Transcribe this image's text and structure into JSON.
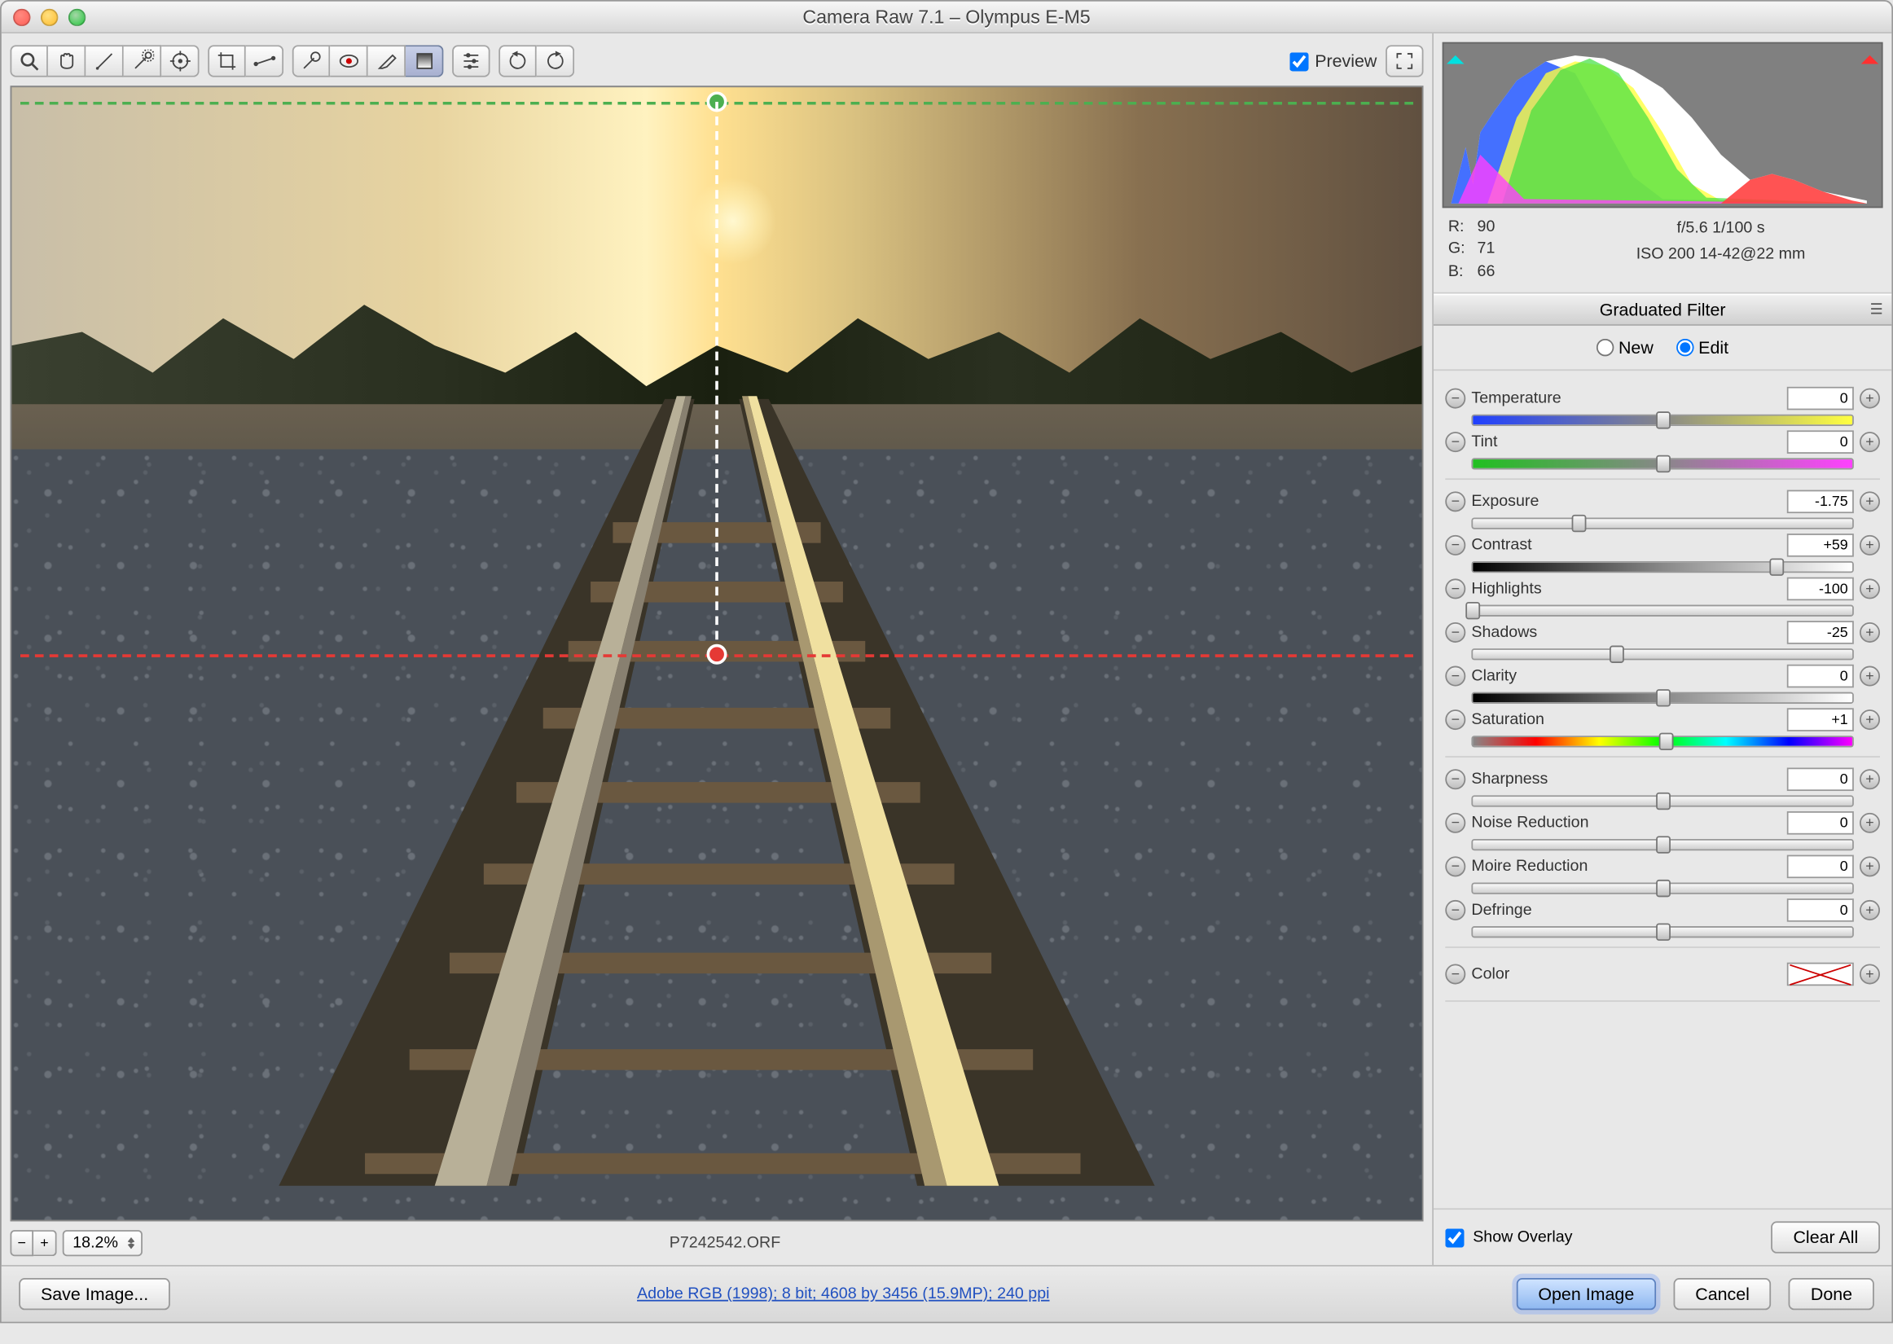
{
  "title": "Camera Raw 7.1  –  Olympus E-M5",
  "toolbar": {
    "preview_label": "Preview",
    "preview_checked": true
  },
  "zoom": "18.2%",
  "filename": "P7242542.ORF",
  "workflow_link": "Adobe RGB (1998); 8 bit; 4608 by 3456 (15.9MP); 240 ppi",
  "buttons": {
    "save": "Save Image...",
    "open": "Open Image",
    "cancel": "Cancel",
    "done": "Done",
    "clear_all": "Clear All"
  },
  "rgb": {
    "r_label": "R:",
    "r": "90",
    "g_label": "G:",
    "g": "71",
    "b_label": "B:",
    "b": "66"
  },
  "camera": {
    "line1": "f/5.6   1/100 s",
    "line2": "ISO 200   14-42@22 mm"
  },
  "panel": {
    "title": "Graduated Filter",
    "new": "New",
    "edit": "Edit"
  },
  "sliders": {
    "temperature": {
      "label": "Temperature",
      "value": "0",
      "pos": 50
    },
    "tint": {
      "label": "Tint",
      "value": "0",
      "pos": 50
    },
    "exposure": {
      "label": "Exposure",
      "value": "-1.75",
      "pos": 28
    },
    "contrast": {
      "label": "Contrast",
      "value": "+59",
      "pos": 80
    },
    "highlights": {
      "label": "Highlights",
      "value": "-100",
      "pos": 0
    },
    "shadows": {
      "label": "Shadows",
      "value": "-25",
      "pos": 38
    },
    "clarity": {
      "label": "Clarity",
      "value": "0",
      "pos": 50
    },
    "saturation": {
      "label": "Saturation",
      "value": "+1",
      "pos": 51
    },
    "sharpness": {
      "label": "Sharpness",
      "value": "0",
      "pos": 50
    },
    "noise": {
      "label": "Noise Reduction",
      "value": "0",
      "pos": 50
    },
    "moire": {
      "label": "Moire Reduction",
      "value": "0",
      "pos": 50
    },
    "defringe": {
      "label": "Defringe",
      "value": "0",
      "pos": 50
    }
  },
  "color_label": "Color",
  "show_overlay": "Show Overlay"
}
